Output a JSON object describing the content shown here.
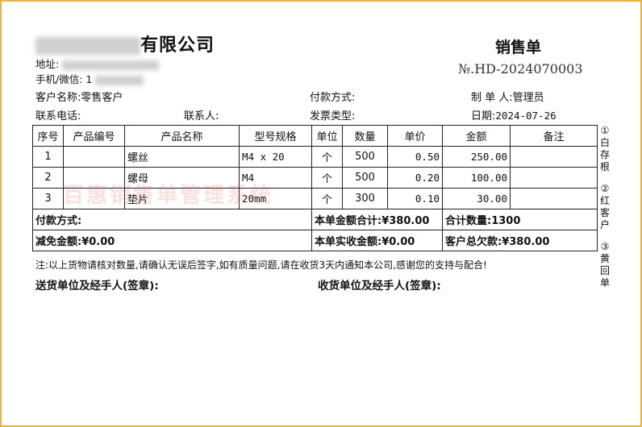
{
  "header": {
    "company_name_visible": "有限公司",
    "doc_title": "销售单",
    "order_no": "№.HD-2024070003",
    "address_label": "地址:",
    "phone_label": "手机/微信:",
    "phone_visible": "1"
  },
  "info": {
    "customer_label": "客户名称:",
    "customer_value": "零售客户",
    "payment_label": "付款方式:",
    "maker_label": "制 单 人:",
    "maker_value": "管理员",
    "contact_phone_label": "联系电话:",
    "contact_person_label": "联系人:",
    "invoice_label": "发票类型:",
    "date_label": "日期:",
    "date_value": "2024-07-26"
  },
  "table": {
    "headers": [
      "序号",
      "产品编号",
      "产品名称",
      "型号规格",
      "单位",
      "数量",
      "单价",
      "金额",
      "备注"
    ],
    "rows": [
      {
        "no": "1",
        "code": "",
        "name": "螺丝",
        "spec": "M4 x 20",
        "unit": "个",
        "qty": "500",
        "price": "0.50",
        "amount": "250.00",
        "remark": ""
      },
      {
        "no": "2",
        "code": "",
        "name": "螺母",
        "spec": "M4",
        "unit": "个",
        "qty": "500",
        "price": "0.20",
        "amount": "100.00",
        "remark": ""
      },
      {
        "no": "3",
        "code": "",
        "name": "垫片",
        "spec": "20mm",
        "unit": "个",
        "qty": "300",
        "price": "0.10",
        "amount": "30.00",
        "remark": ""
      }
    ],
    "summary": {
      "pay_method": "付款方式:",
      "total_amount": "本单金额合计:¥380.00",
      "total_qty": "合计数量:1300",
      "discount": "减免金额:¥0.00",
      "received": "本单实收金额:¥0.00",
      "owed": "客户总欠款:¥380.00"
    }
  },
  "watermark": "百惠销售单管理系统",
  "footer": {
    "note": "注:以上货物请核对数量,请确认无误后签字,如有质量问题,请在收货3天内通知本公司,感谢您的支持与配合!",
    "sender": "送货单位及经手人(签章):",
    "receiver": "收货单位及经手人(签章):"
  },
  "copies": [
    {
      "num": "①",
      "label": "白存根"
    },
    {
      "num": "②",
      "label": "红客户"
    },
    {
      "num": "③",
      "label": "黄回单"
    }
  ],
  "colors": {
    "border": "#e3b34a",
    "watermark": "#e65a5a"
  }
}
